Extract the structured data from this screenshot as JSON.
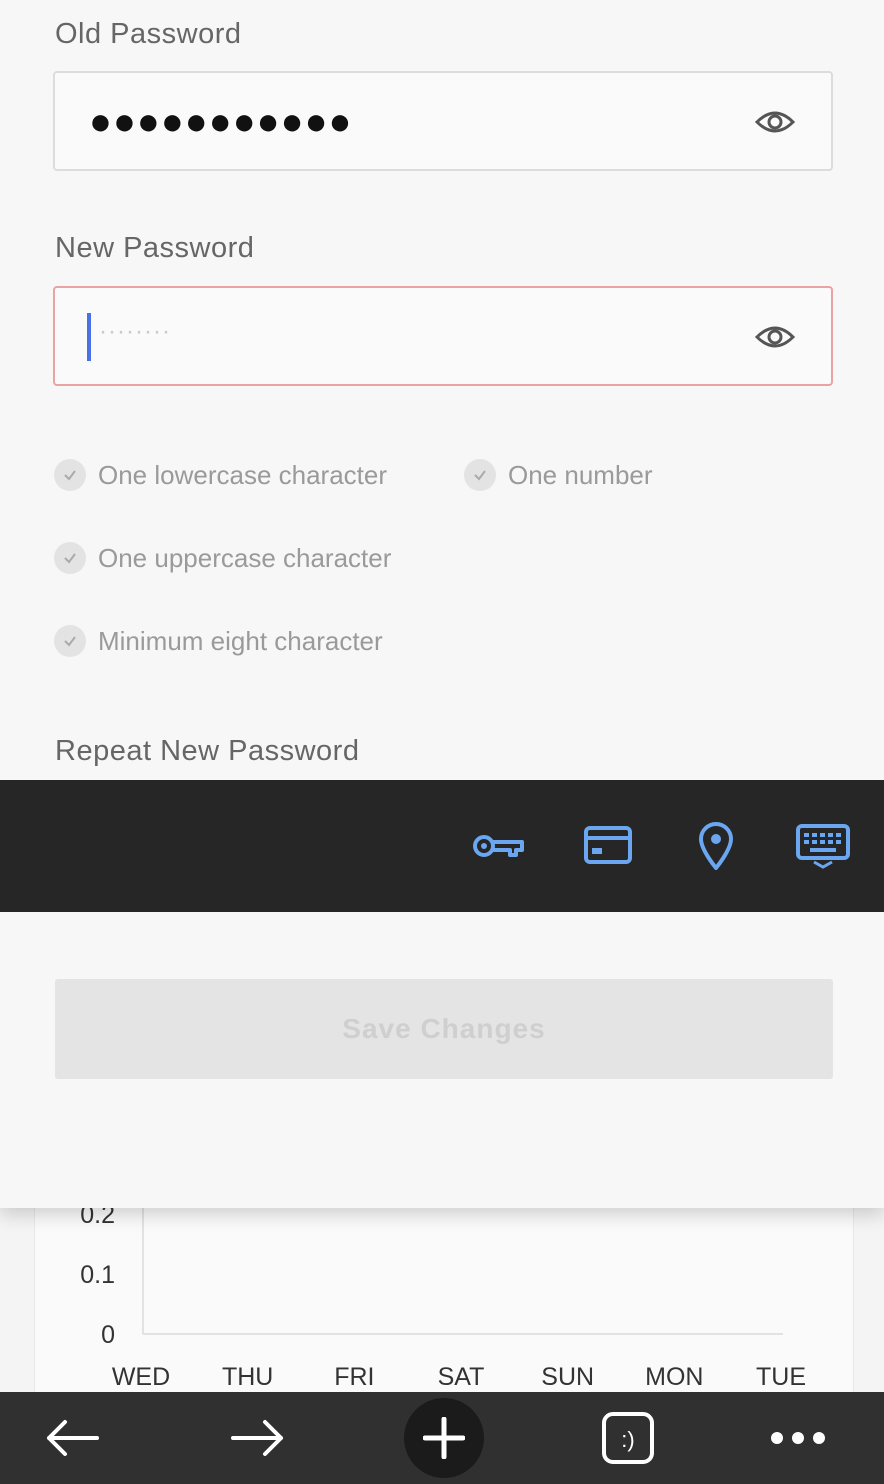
{
  "form": {
    "old_password": {
      "label": "Old Password",
      "value": "●●●●●●●●●●●"
    },
    "new_password": {
      "label": "New Password",
      "placeholder": "········"
    },
    "rules": [
      "One lowercase character",
      "One number",
      "One uppercase character",
      "Minimum eight character"
    ],
    "repeat_password": {
      "label": "Repeat New Password"
    },
    "save_label": "Save Changes",
    "error_color": "#e8a4a4",
    "caret_color": "#4a72e8"
  },
  "autofill_bar": {
    "icons": [
      "key-icon",
      "credit-card-icon",
      "location-pin-icon",
      "keyboard-icon"
    ],
    "icon_color": "#6aa7f0"
  },
  "chart_data": {
    "type": "line",
    "categories": [
      "WED",
      "THU",
      "FRI",
      "SAT",
      "SUN",
      "MON",
      "TUE"
    ],
    "y_ticks": [
      "0",
      "0.1",
      "0.2"
    ],
    "series": [],
    "ylim": [
      0,
      0.2
    ]
  },
  "toolbar": {
    "icons": [
      "back-arrow-icon",
      "forward-arrow-icon",
      "new-tab-plus-icon",
      "tabs-switcher-icon",
      "more-menu-icon"
    ],
    "tab_switcher_label": ":)"
  }
}
